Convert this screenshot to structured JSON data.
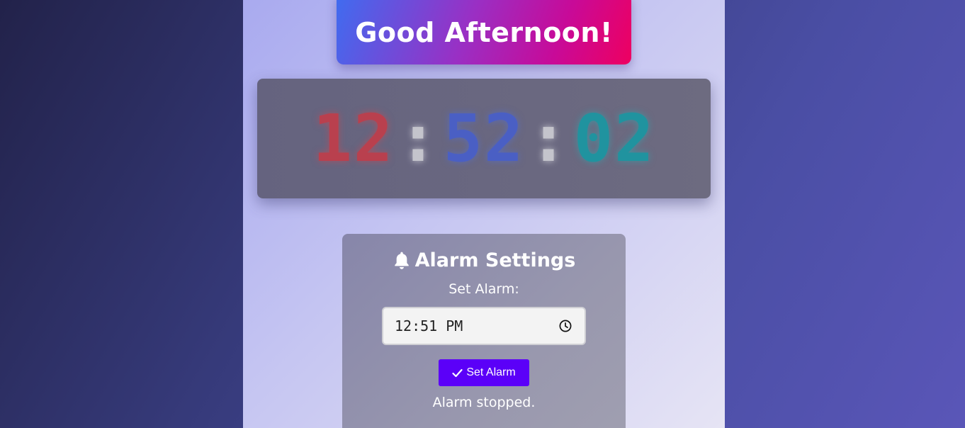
{
  "greeting": "Good Afternoon!",
  "clock": {
    "hours": "12",
    "minutes": "52",
    "seconds": "02",
    "separator": ":"
  },
  "alarm": {
    "title": "Alarm Settings",
    "title_icon": "bell-icon",
    "set_label": "Set Alarm:",
    "time_value": "12:51 PM",
    "time_icon": "clock-icon",
    "button_label": "Set Alarm",
    "button_icon": "check-icon",
    "status": "Alarm stopped."
  },
  "colors": {
    "hours": "#b9404e",
    "minutes": "#4a5fc4",
    "seconds": "#20939f",
    "button": "#5b00f8"
  }
}
